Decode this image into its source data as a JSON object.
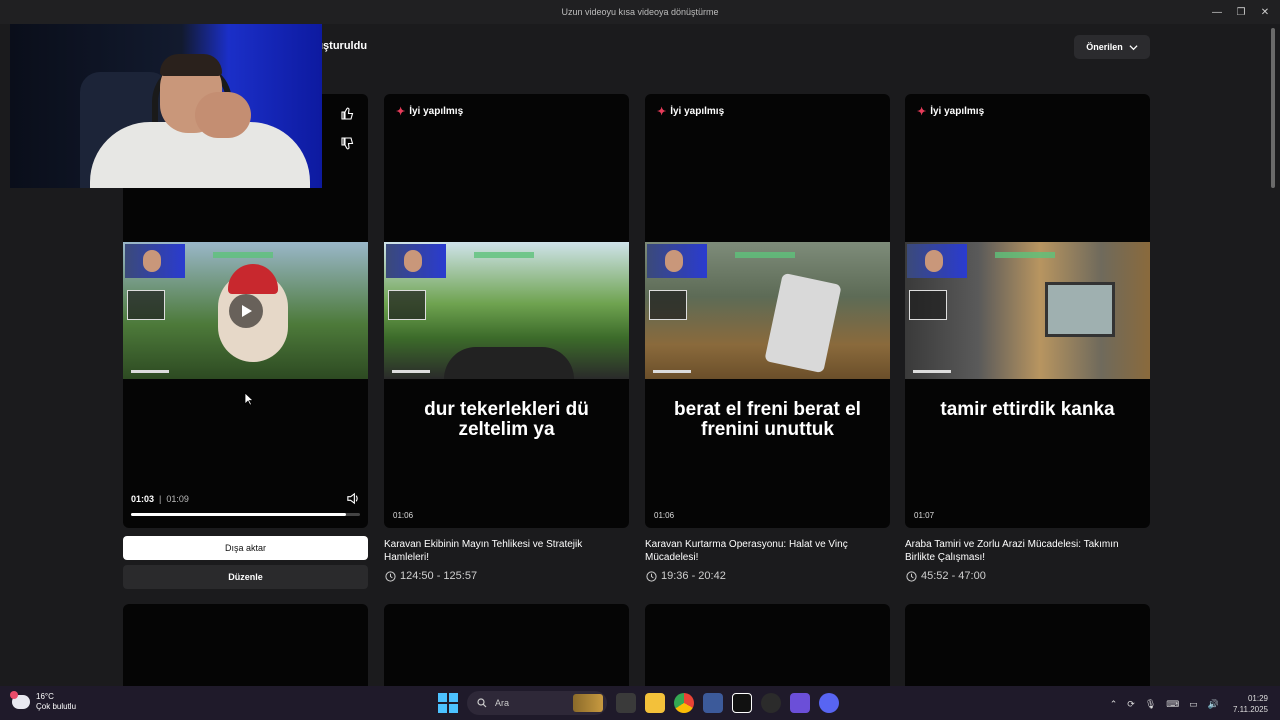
{
  "window": {
    "title": "Uzun videoyu kısa videoya dönüştürme",
    "controls": [
      "—",
      "❐",
      "✕"
    ]
  },
  "header": {
    "title": "ışturuldu",
    "sort_label": "Önerilen"
  },
  "cards": [
    {
      "badge": "",
      "caption": "",
      "duration": "",
      "current_time": "01:03",
      "separator": "|",
      "total_time": "01:09",
      "progress": 0.94
    },
    {
      "badge": "İyi yapılmış",
      "caption": "dur tekerlekleri dü zeltelim ya",
      "duration": "01:06",
      "title": "Karavan Ekibinin Mayın Tehlikesi ve Stratejik Hamleleri!",
      "range": "124:50 - 125:57"
    },
    {
      "badge": "İyi yapılmış",
      "caption": "berat el freni  berat el frenini unuttuk",
      "duration": "01:06",
      "title": "Karavan Kurtarma Operasyonu: Halat ve Vinç Mücadelesi!",
      "range": "19:36 - 20:42"
    },
    {
      "badge": "İyi yapılmış",
      "caption": "tamir ettirdik kanka",
      "duration": "01:07",
      "title": "Araba Tamiri ve Zorlu Arazi Mücadelesi: Takımın Birlikte Çalışması!",
      "range": "45:52 - 47:00"
    }
  ],
  "actions": {
    "export_label": "Dışa aktar",
    "edit_label": "Düzenle"
  },
  "taskbar": {
    "temperature": "16°C",
    "weather": "Çok bulutlu",
    "search_placeholder": "Ara",
    "time": "01:29",
    "date": "7.11.2025"
  },
  "colors": {
    "accent": "#e83c5a",
    "background": "#1b1b1d",
    "card": "#050505"
  },
  "icons": [
    "thumbs-up-icon",
    "thumbs-down-icon",
    "play-icon",
    "volume-icon",
    "clock-icon",
    "chevron-down-icon",
    "search-icon"
  ]
}
